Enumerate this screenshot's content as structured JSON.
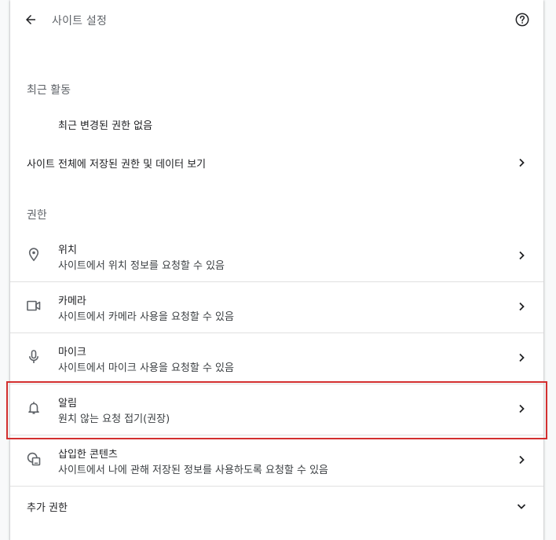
{
  "header": {
    "title": "사이트 설정"
  },
  "recent": {
    "section_title": "최근 활동",
    "empty_text": "최근 변경된 권한 없음"
  },
  "all_sites": {
    "label": "사이트 전체에 저장된 권한 및 데이터 보기"
  },
  "permissions": {
    "section_title": "권한",
    "items": [
      {
        "name": "위치",
        "desc": "사이트에서 위치 정보를 요청할 수 있음",
        "icon": "location-pin-icon"
      },
      {
        "name": "카메라",
        "desc": "사이트에서 카메라 사용을 요청할 수 있음",
        "icon": "camera-icon"
      },
      {
        "name": "마이크",
        "desc": "사이트에서 마이크 사용을 요청할 수 있음",
        "icon": "microphone-icon"
      },
      {
        "name": "알림",
        "desc": "원치 않는 요청 접기(권장)",
        "icon": "bell-icon"
      },
      {
        "name": "삽입한 콘텐츠",
        "desc": "사이트에서 나에 관해 저장된 정보를 사용하도록 요청할 수 있음",
        "icon": "embedded-content-icon"
      }
    ]
  },
  "additional": {
    "label": "추가 권한"
  },
  "colors": {
    "highlight": "#d32f2f",
    "divider": "#e0e0e0",
    "secondary_text": "#5f6368"
  }
}
